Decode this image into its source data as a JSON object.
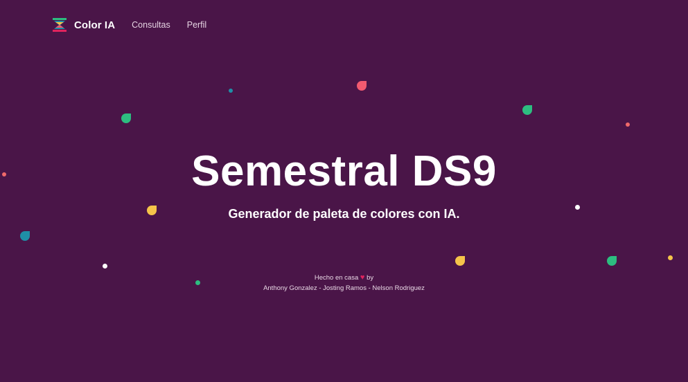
{
  "nav": {
    "brand": "Color IA",
    "links": [
      "Consultas",
      "Perfil"
    ]
  },
  "hero": {
    "title": "Semestral DS9",
    "subtitle": "Generador de paleta de colores con IA."
  },
  "credits": {
    "made_prefix": "Hecho en casa",
    "made_suffix": "by",
    "authors": "Anthony Gonzalez - Josting Ramos - Nelson Rodriguez"
  },
  "colors": {
    "background": "#4a1548",
    "confetti": [
      "#f25a70",
      "#2dbd80",
      "#f5c44a",
      "#1f8fa7",
      "#ffffff",
      "#f06a6a"
    ]
  }
}
